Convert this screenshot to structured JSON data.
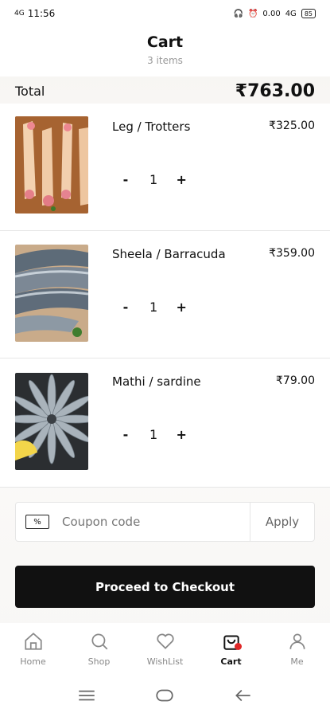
{
  "status": {
    "signal": "4G",
    "time": "11:56",
    "net_speed": "0.00",
    "net_unit": "KB/S",
    "network": "4G",
    "battery": "85"
  },
  "header": {
    "title": "Cart",
    "subtitle": "3 items"
  },
  "total": {
    "label": "Total",
    "amount": "₹763.00"
  },
  "items": [
    {
      "name": "Leg / Trotters",
      "price": "₹325.00",
      "qty": "1",
      "minus": "-",
      "plus": "+"
    },
    {
      "name": "Sheela / Barracuda",
      "price": "₹359.00",
      "qty": "1",
      "minus": "-",
      "plus": "+"
    },
    {
      "name": "Mathi / sardine",
      "price": "₹79.00",
      "qty": "1",
      "minus": "-",
      "plus": "+"
    }
  ],
  "coupon": {
    "placeholder": "Coupon code",
    "apply_label": "Apply"
  },
  "checkout": {
    "label": "Proceed to Checkout"
  },
  "tabs": [
    {
      "label": "Home",
      "icon": "home-icon"
    },
    {
      "label": "Shop",
      "icon": "search-icon"
    },
    {
      "label": "WishList",
      "icon": "heart-icon"
    },
    {
      "label": "Cart",
      "icon": "shopping-bag-icon",
      "active": true
    },
    {
      "label": "Me",
      "icon": "person-icon"
    }
  ],
  "colors": {
    "accent": "#111111",
    "badge": "#e02828"
  }
}
